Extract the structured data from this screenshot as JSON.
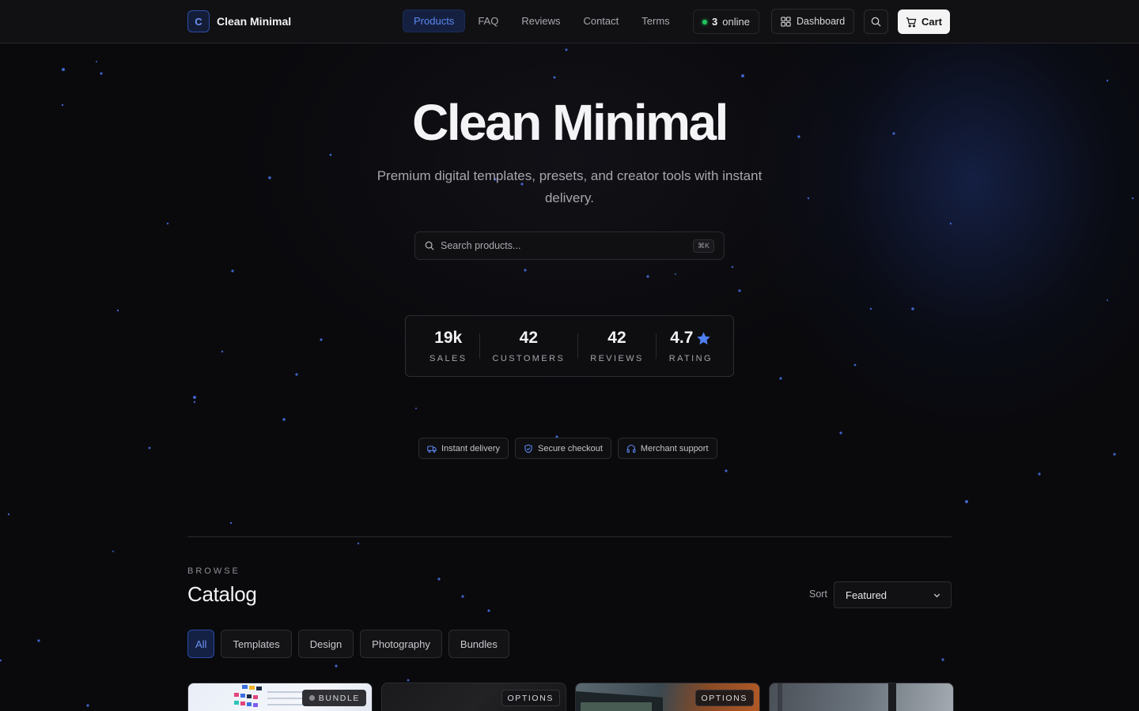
{
  "nav": {
    "brand_letter": "C",
    "brand_name": "Clean Minimal",
    "links": [
      "Products",
      "FAQ",
      "Reviews",
      "Contact",
      "Terms"
    ],
    "online_count": "3",
    "online_label": "online",
    "dashboard_label": "Dashboard",
    "cart_label": "Cart"
  },
  "hero": {
    "title": "Clean Minimal",
    "subtitle": "Premium digital templates, presets, and creator tools with instant delivery.",
    "search_placeholder": "Search products...",
    "search_shortcut": "⌘K"
  },
  "stats": [
    {
      "value": "19k",
      "label": "SALES"
    },
    {
      "value": "42",
      "label": "CUSTOMERS"
    },
    {
      "value": "42",
      "label": "REVIEWS"
    },
    {
      "value": "4.7",
      "label": "RATING"
    }
  ],
  "badges": [
    "Instant delivery",
    "Secure checkout",
    "Merchant support"
  ],
  "catalog": {
    "eyebrow": "BROWSE",
    "title": "Catalog",
    "sort_label": "Sort",
    "sort_value": "Featured",
    "filters": [
      "All",
      "Templates",
      "Design",
      "Photography",
      "Bundles"
    ],
    "cards": [
      {
        "tag": "BUNDLE"
      },
      {
        "tag": "OPTIONS"
      },
      {
        "tag": "OPTIONS"
      },
      {
        "tag": ""
      }
    ]
  },
  "colors": {
    "accent": "#5b86f0",
    "online": "#22c55e",
    "background": "#0a0a0d"
  }
}
